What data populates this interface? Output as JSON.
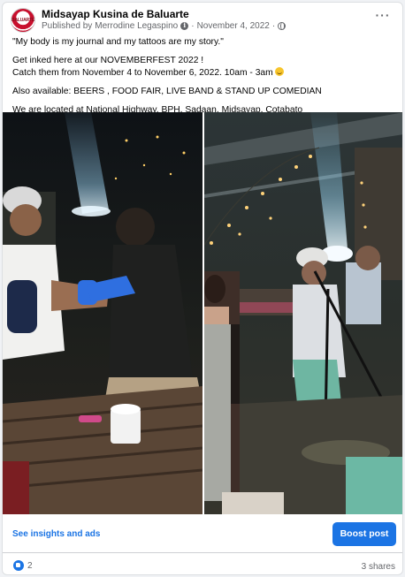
{
  "post": {
    "page_name": "Midsayap Kusina de Baluarte",
    "avatar_text": "BALUARTE",
    "published_prefix": "Published by",
    "author": "Merrodine Legaspino",
    "separator": "·",
    "date": "November 4, 2022",
    "date_separator": "·",
    "lines": [
      "\"My body is my journal and my tattoos are my story.\"",
      "Get inked here at our NOVEMBERFEST 2022 !",
      "Catch them from November 4 to November 6, 2022. 10am - 3am",
      "Also available: BEERS , FOOD FAIR, LIVE BAND & STAND UP COMEDIAN",
      "We are located at National Highway, BPH, Sadaan, Midsayap, Cotabato"
    ],
    "photos": [
      {
        "description_icon": "photo-tattoo-artist-working"
      },
      {
        "description_icon": "photo-tattoo-session-wide"
      }
    ]
  },
  "footer": {
    "insights_label": "See insights and ads",
    "boost_label": "Boost post",
    "like_count": "2",
    "shares_label": "3 shares"
  },
  "colors": {
    "accent": "#1b74e4",
    "muted_text": "#65676b",
    "avatar_red": "#c8102e"
  }
}
